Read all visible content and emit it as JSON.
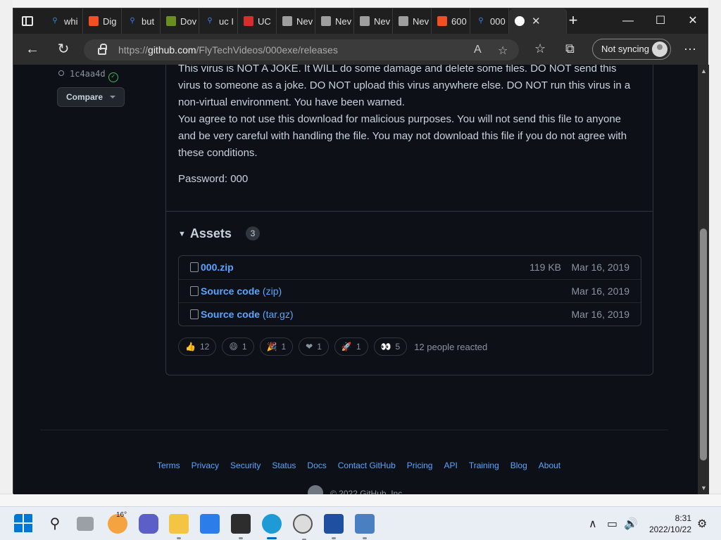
{
  "browser": {
    "tabs": [
      {
        "label": "whi",
        "icon": "search-icon"
      },
      {
        "label": "Dig",
        "icon": "microsoft-icon"
      },
      {
        "label": "but",
        "icon": "search-icon"
      },
      {
        "label": "Dov",
        "icon": "app-icon"
      },
      {
        "label": "uc I",
        "icon": "search-icon"
      },
      {
        "label": "UC",
        "icon": "record-icon"
      },
      {
        "label": "Nev",
        "icon": "page-icon"
      },
      {
        "label": "Nev",
        "icon": "page-icon"
      },
      {
        "label": "Nev",
        "icon": "page-icon"
      },
      {
        "label": "Nev",
        "icon": "page-icon"
      },
      {
        "label": "600",
        "icon": "microsoft-icon"
      },
      {
        "label": "000",
        "icon": "search-icon"
      }
    ],
    "active_tab_icon": "github-icon",
    "url_prefix": "https://",
    "url_host": "github.com",
    "url_path": "/FlyTechVideos/000exe/releases",
    "sync_label": "Not syncing"
  },
  "sidebar": {
    "commit": "1c4aa4d",
    "compare_label": "Compare"
  },
  "release": {
    "body_lines": [
      "This virus is NOT A JOKE. It WILL do some damage and delete some files. DO NOT send this virus to someone as a joke. DO NOT upload this virus anywhere else. DO NOT run this virus in a non-virtual environment. You have been warned.",
      "You agree to not use this download for malicious purposes. You will not send this file to anyone and be very careful with handling the file. You may not download this file if you do not agree with these conditions."
    ],
    "password": "Password: 000",
    "assets_title": "Assets",
    "assets_count": "3",
    "assets": [
      {
        "name": "000.zip",
        "suffix": "",
        "size": "119 KB",
        "date": "Mar 16, 2019",
        "icon": "package-icon"
      },
      {
        "name": "Source code",
        "suffix": " (zip)",
        "size": "",
        "date": "Mar 16, 2019",
        "icon": "file-zip-icon"
      },
      {
        "name": "Source code",
        "suffix": " (tar.gz)",
        "size": "",
        "date": "Mar 16, 2019",
        "icon": "file-zip-icon"
      }
    ],
    "reactions": [
      {
        "emoji": "👍",
        "count": "12",
        "name": "thumbs-up"
      },
      {
        "emoji": "😄",
        "count": "1",
        "name": "smile"
      },
      {
        "emoji": "🎉",
        "count": "1",
        "name": "tada"
      },
      {
        "emoji": "❤",
        "count": "1",
        "name": "heart"
      },
      {
        "emoji": "🚀",
        "count": "1",
        "name": "rocket"
      },
      {
        "emoji": "👀",
        "count": "5",
        "name": "eyes"
      }
    ],
    "reaction_summary": "12 people reacted"
  },
  "footer": {
    "links": [
      "Terms",
      "Privacy",
      "Security",
      "Status",
      "Docs",
      "Contact GitHub",
      "Pricing",
      "API",
      "Training",
      "Blog",
      "About"
    ],
    "copyright": "© 2022 GitHub, Inc."
  },
  "taskbar": {
    "weather_temp": "16°",
    "time": "8:31",
    "date": "2022/10/22"
  },
  "colors": {
    "page_bg": "#0d1117",
    "link": "#58a6ff",
    "text": "#c9d1d9",
    "muted": "#8b949e",
    "border": "#30363d"
  }
}
